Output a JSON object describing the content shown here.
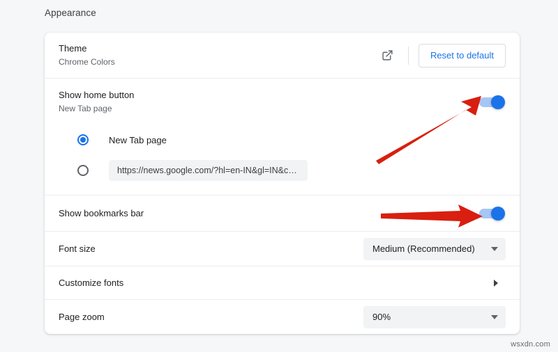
{
  "section": {
    "title": "Appearance"
  },
  "theme_row": {
    "name": "Theme",
    "value": "Chrome Colors",
    "open_icon": "external-link-icon",
    "reset_button": "Reset to default"
  },
  "home_button_row": {
    "name": "Show home button",
    "value": "New Tab page",
    "toggle_state": "on",
    "options": [
      {
        "label": "New Tab page",
        "selected": true,
        "type": "label"
      },
      {
        "label": "https://news.google.com/?hl=en-IN&gl=IN&c…",
        "selected": false,
        "type": "url"
      }
    ]
  },
  "bookmarks_row": {
    "name": "Show bookmarks bar",
    "toggle_state": "on"
  },
  "font_size_row": {
    "name": "Font size",
    "value": "Medium (Recommended)",
    "control": "dropdown",
    "icon": "chevron-down-icon"
  },
  "customize_fonts_row": {
    "name": "Customize fonts",
    "control": "submenu",
    "icon": "chevron-right-icon"
  },
  "page_zoom_row": {
    "name": "Page zoom",
    "value": "90%",
    "control": "dropdown",
    "icon": "chevron-down-icon"
  },
  "annotations": [
    {
      "name": "arrow-to-home-button-toggle",
      "shape": "diagonal-arrow",
      "color": "#d81f10"
    },
    {
      "name": "arrow-to-bookmarks-bar-toggle",
      "shape": "horizontal-arrow",
      "color": "#d81f10"
    }
  ],
  "watermark": {
    "text": "wsxdn.com"
  },
  "colors": {
    "accent": "#1a73e8",
    "toggle_track": "#a6c6f5",
    "page_background": "#f6f7f9",
    "card_background": "#ffffff",
    "annotation_red": "#d81f10"
  }
}
